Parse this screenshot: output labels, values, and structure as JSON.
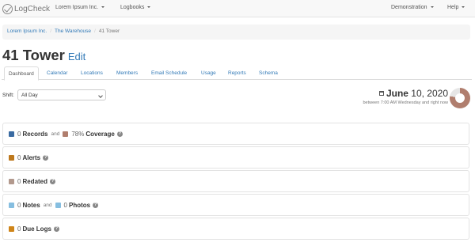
{
  "navbar": {
    "brand": "LogCheck",
    "org_menu": "Lorem Ipsum Inc.",
    "logbooks_menu": "Logbooks",
    "demo_menu": "Demonstration",
    "help_menu": "Help"
  },
  "breadcrumb": {
    "items": [
      "Lorem Ipsum Inc.",
      "The Warehouse"
    ],
    "active": "41 Tower",
    "separator": "/"
  },
  "page": {
    "title": "41 Tower",
    "edit_label": "Edit"
  },
  "tabs": [
    "Dashboard",
    "Calendar",
    "Locations",
    "Members",
    "Email Schedule",
    "Usage",
    "Reports",
    "Schema"
  ],
  "active_tab": "Dashboard",
  "shift": {
    "label": "Shift:",
    "selected": "All Day"
  },
  "date": {
    "month_day": "June",
    "rest": " 10, 2020",
    "range": "between 7:00 AM Wednesday and right now",
    "coverage_fraction": 0.78
  },
  "panels": {
    "records": {
      "count": "0",
      "label": "Records",
      "and": "and",
      "coverage_pct": "78%",
      "coverage_label": "Coverage"
    },
    "alerts": {
      "count": "0",
      "label": "Alerts"
    },
    "redated": {
      "count": "0",
      "label": "Redated"
    },
    "notes": {
      "count": "0",
      "label": "Notes",
      "and": "and",
      "photos_count": "0",
      "photos_label": "Photos"
    },
    "due_logs": {
      "count": "0",
      "label": "Due Logs"
    }
  },
  "help_glyph": "?",
  "colors": {
    "link": "#337ab7",
    "records": "#5b8fc7",
    "coverage": "#b07e6e",
    "alerts": "#d89a3e",
    "redated": "#d7c4ba",
    "notes": "#86bee0",
    "due_logs": "#e9a23b"
  }
}
